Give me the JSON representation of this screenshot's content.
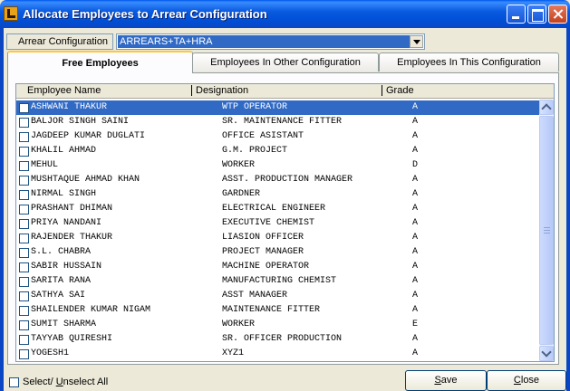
{
  "window": {
    "title": "Allocate Employees to Arrear Configuration"
  },
  "config": {
    "label": "Arrear Configuration",
    "value": "ARREARS+TA+HRA"
  },
  "tabs": [
    {
      "label": "Free Employees",
      "active": true
    },
    {
      "label": "Employees In Other Configuration",
      "active": false
    },
    {
      "label": "Employees In This Configuration",
      "active": false
    }
  ],
  "grid": {
    "columns": [
      "Employee Name",
      "Designation",
      "Grade"
    ],
    "rows": [
      {
        "name": "ASHWANI THAKUR",
        "designation": "WTP OPERATOR",
        "grade": "A",
        "selected": true
      },
      {
        "name": "BALJOR SINGH SAINI",
        "designation": "SR. MAINTENANCE FITTER",
        "grade": "A"
      },
      {
        "name": "JAGDEEP KUMAR DUGLATI",
        "designation": "OFFICE ASISTANT",
        "grade": "A"
      },
      {
        "name": "KHALIL AHMAD",
        "designation": " G.M. PROJECT",
        "grade": "A"
      },
      {
        "name": "MEHUL",
        "designation": "WORKER",
        "grade": "D"
      },
      {
        "name": "MUSHTAQUE AHMAD KHAN",
        "designation": "ASST. PRODUCTION MANAGER",
        "grade": "A"
      },
      {
        "name": "NIRMAL SINGH",
        "designation": "GARDNER",
        "grade": "A"
      },
      {
        "name": "PRASHANT DHIMAN",
        "designation": "ELECTRICAL ENGINEER",
        "grade": "A"
      },
      {
        "name": "PRIYA NANDANI",
        "designation": "EXECUTIVE CHEMIST",
        "grade": "A"
      },
      {
        "name": "RAJENDER THAKUR",
        "designation": "LIASION OFFICER",
        "grade": "A"
      },
      {
        "name": "S.L. CHABRA",
        "designation": "PROJECT MANAGER",
        "grade": "A"
      },
      {
        "name": "SABIR HUSSAIN",
        "designation": "MACHINE OPERATOR",
        "grade": "A"
      },
      {
        "name": "SARITA RANA",
        "designation": "MANUFACTURING CHEMIST",
        "grade": "A"
      },
      {
        "name": "SATHYA SAI",
        "designation": "ASST MANAGER",
        "grade": "A"
      },
      {
        "name": "SHAILENDER KUMAR NIGAM",
        "designation": "MAINTENANCE FITTER",
        "grade": "A"
      },
      {
        "name": "SUMIT SHARMA",
        "designation": "WORKER",
        "grade": "E"
      },
      {
        "name": "TAYYAB QUIRESHI",
        "designation": "SR. OFFICER PRODUCTION",
        "grade": "A"
      },
      {
        "name": "YOGESH1",
        "designation": "XYZ1",
        "grade": "A"
      }
    ]
  },
  "footer": {
    "select_all_pre": "Select/ ",
    "select_all_u": "U",
    "select_all_post": "nselect All",
    "save_u": "S",
    "save_post": "ave",
    "close_u": "C",
    "close_post": "lose"
  },
  "icons": {
    "app": "app-icon",
    "minimize": "minimize-icon",
    "maximize": "maximize-icon",
    "close": "close-icon",
    "dropdown": "chevron-down-icon",
    "scroll_up": "chevron-up-icon",
    "scroll_down": "chevron-down-icon"
  },
  "colors": {
    "titlebar": "#0a5be0",
    "selection": "#316ac5",
    "tab_highlight": "#ffc83c",
    "face": "#ece9d8"
  }
}
